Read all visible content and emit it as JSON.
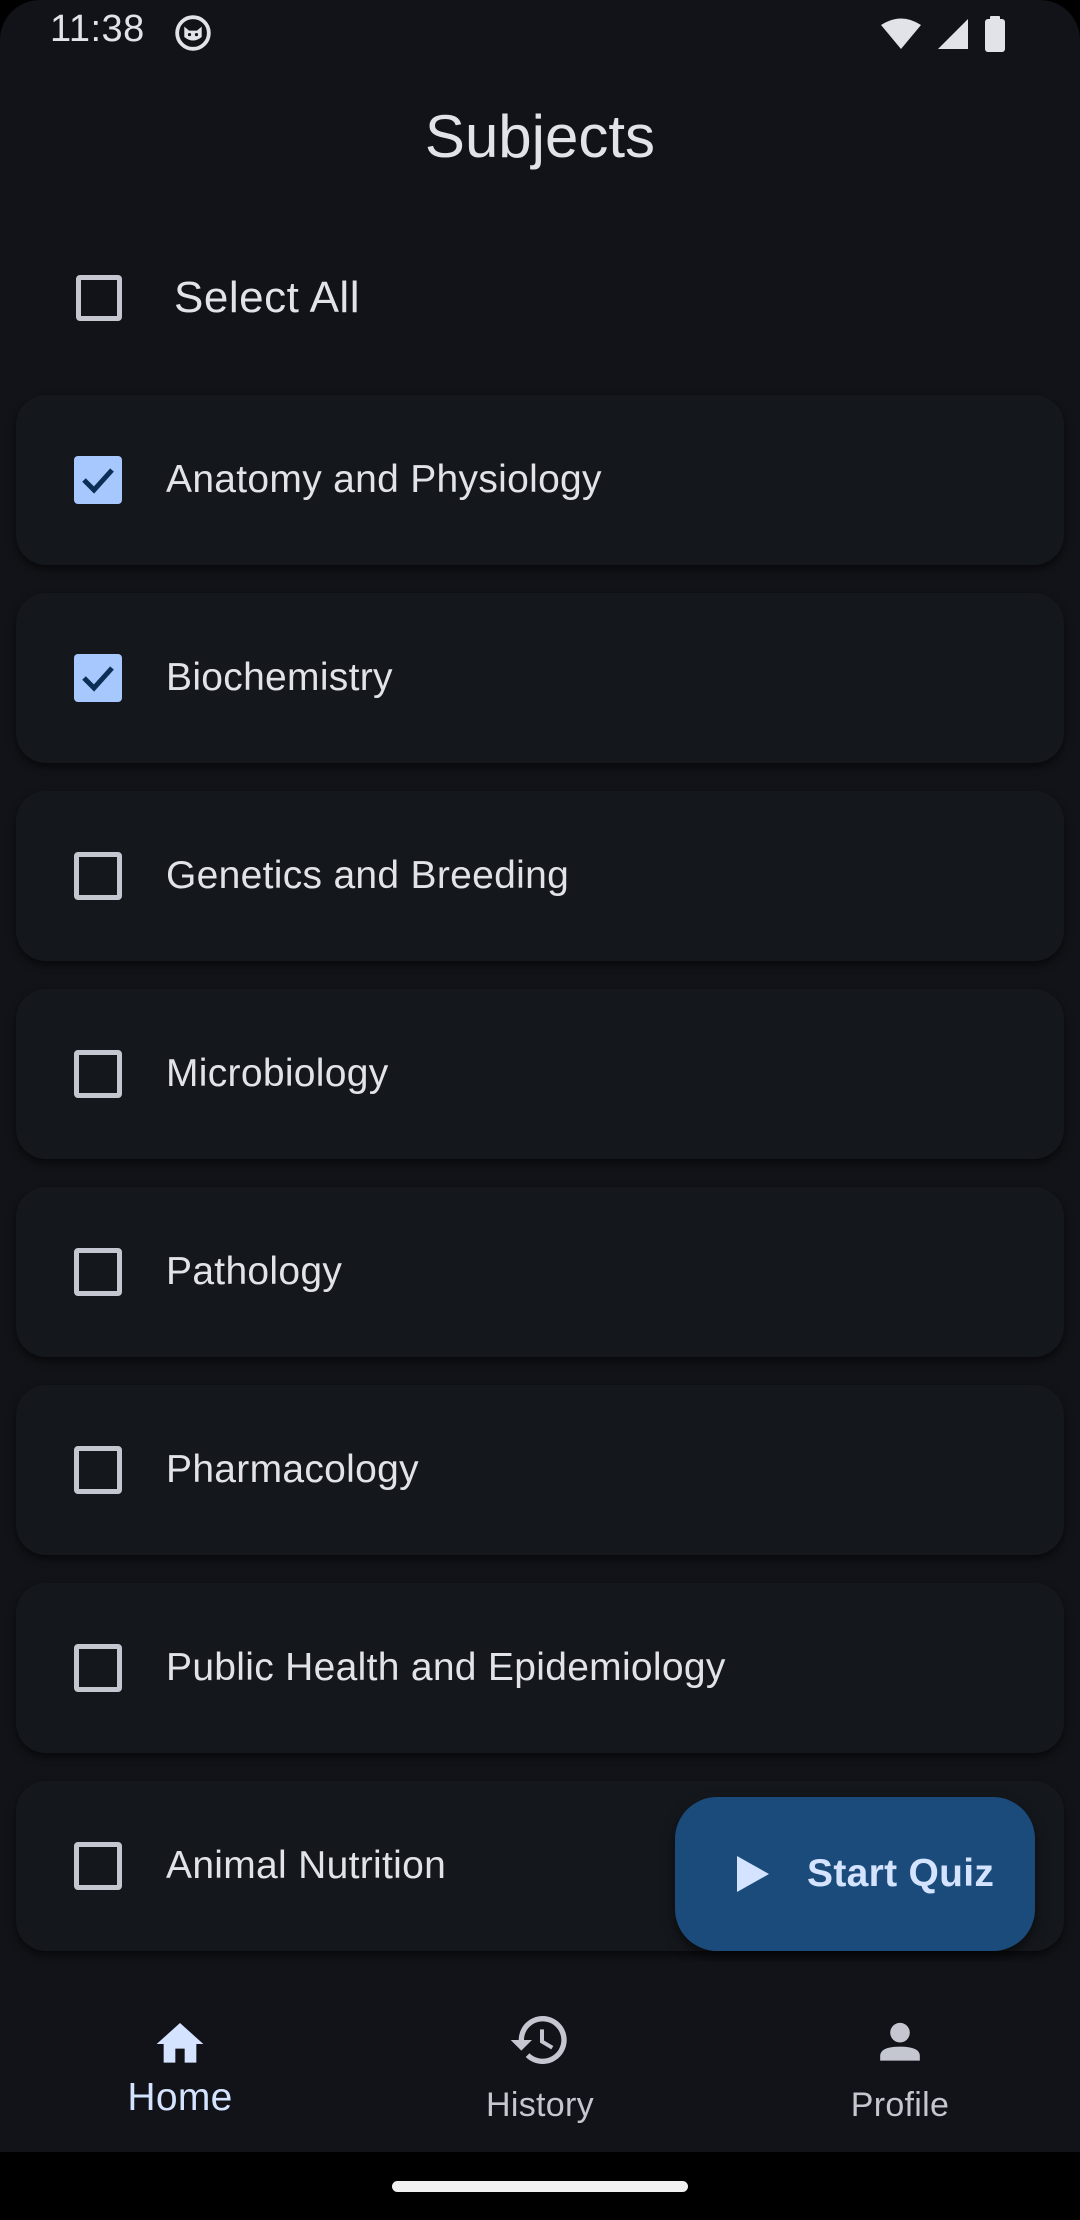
{
  "status_bar": {
    "time": "11:38"
  },
  "page": {
    "title": "Subjects"
  },
  "select_all": {
    "label": "Select All",
    "checked": false
  },
  "subjects": [
    {
      "label": "Anatomy and Physiology",
      "checked": true
    },
    {
      "label": "Biochemistry",
      "checked": true
    },
    {
      "label": "Genetics and Breeding",
      "checked": false
    },
    {
      "label": "Microbiology",
      "checked": false
    },
    {
      "label": "Pathology",
      "checked": false
    },
    {
      "label": "Pharmacology",
      "checked": false
    },
    {
      "label": "Public Health and Epidemiology",
      "checked": false
    },
    {
      "label": "Animal Nutrition",
      "checked": false
    }
  ],
  "fab": {
    "label": "Start Quiz",
    "icon": "play-icon"
  },
  "bottom_nav": {
    "items": [
      {
        "label": "Home",
        "icon": "home-icon",
        "active": true
      },
      {
        "label": "History",
        "icon": "history-icon",
        "active": false
      },
      {
        "label": "Profile",
        "icon": "person-icon",
        "active": false
      }
    ]
  },
  "colors": {
    "background": "#111318",
    "card": "#14171c",
    "text": "#e2e2e9",
    "checkbox_checked": "#a6c8ff",
    "fab_background": "#1b4b7b",
    "fab_text": "#d4e3ff"
  }
}
